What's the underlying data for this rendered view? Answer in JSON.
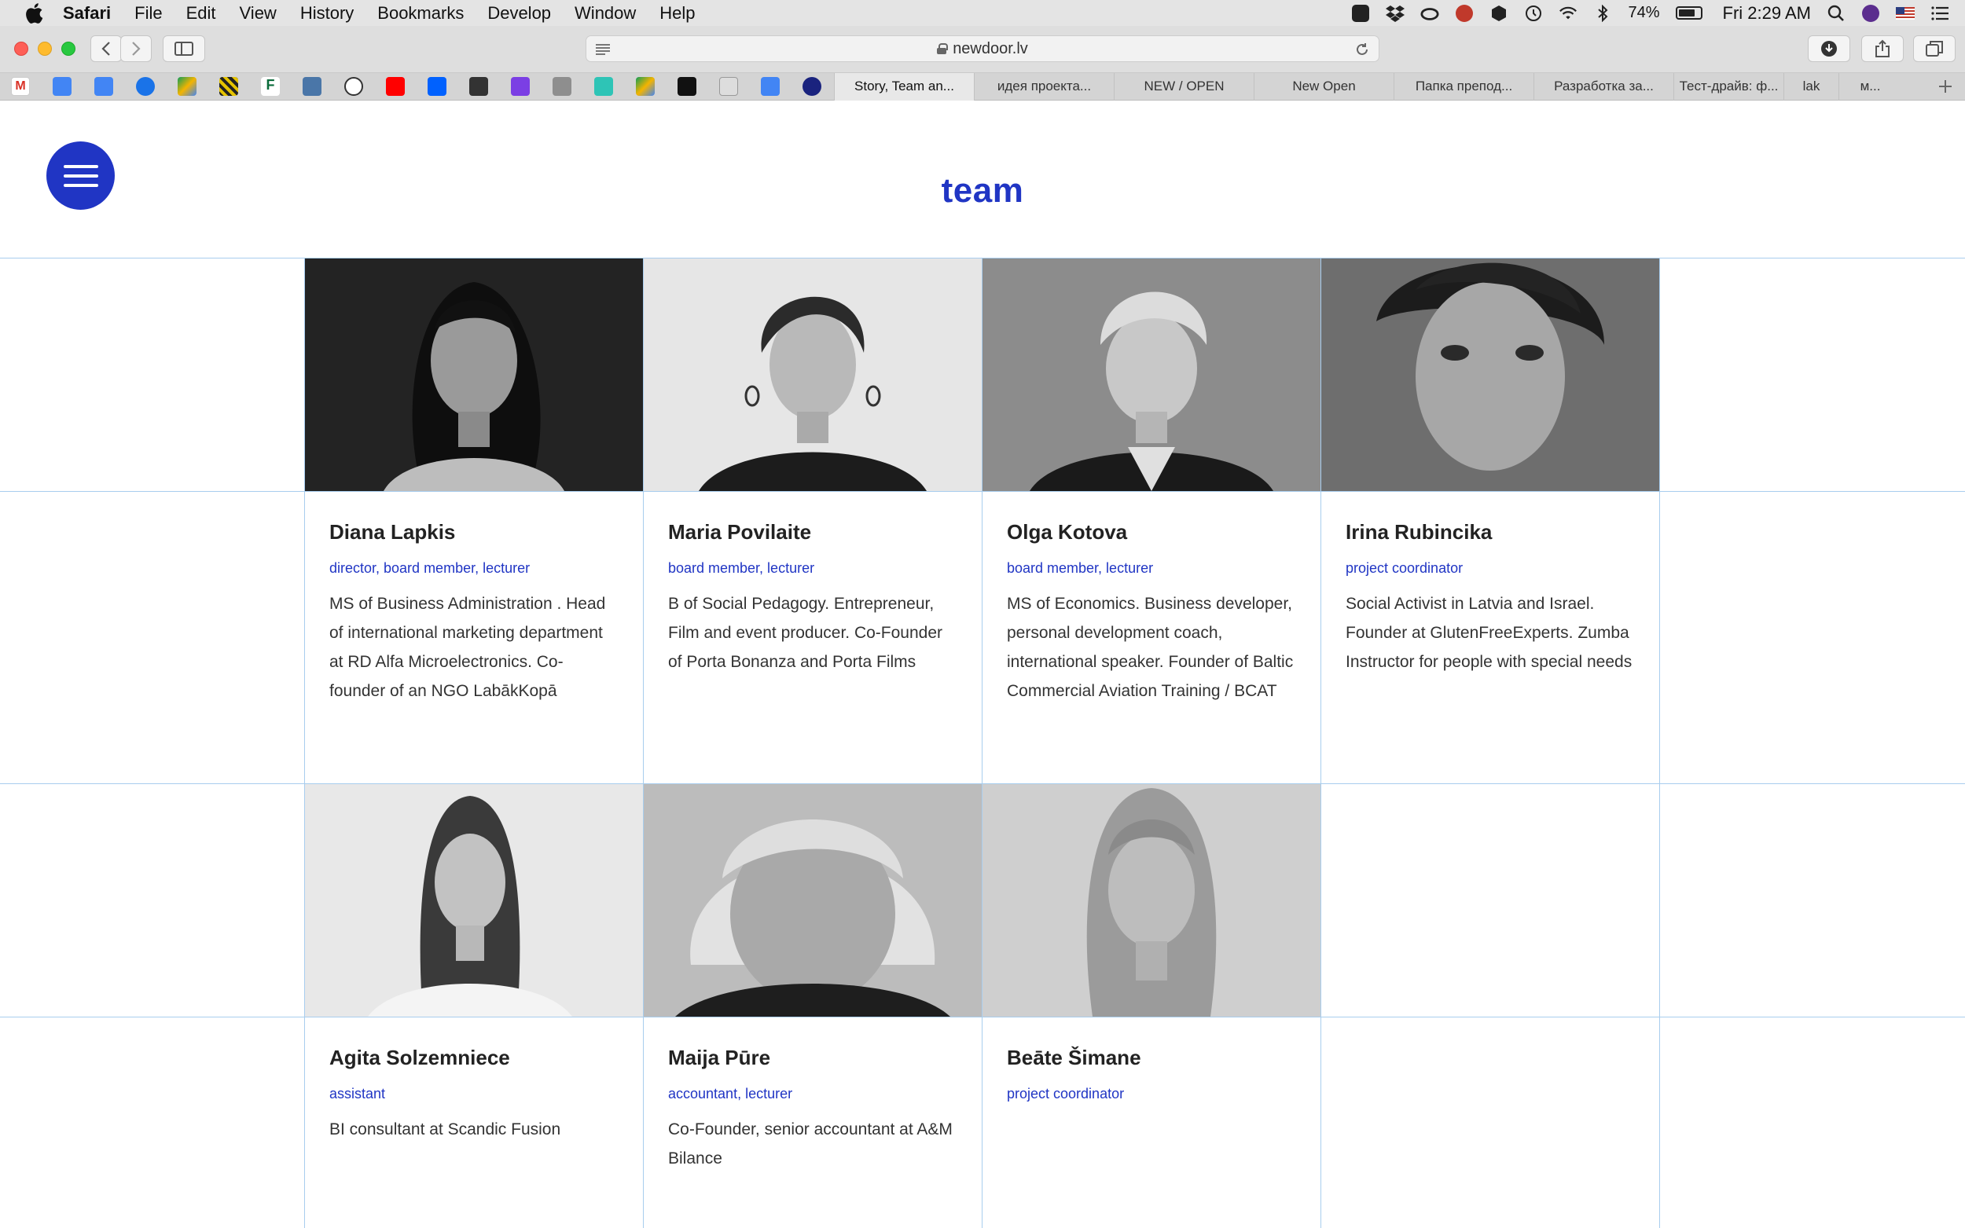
{
  "menubar": {
    "app": "Safari",
    "items": [
      "File",
      "Edit",
      "View",
      "History",
      "Bookmarks",
      "Develop",
      "Window",
      "Help"
    ],
    "battery": "74%",
    "clock": "Fri 2:29 AM"
  },
  "toolbar": {
    "url": "newdoor.lv"
  },
  "tabs": [
    "Story, Team an...",
    "идея проекта...",
    "NEW / OPEN",
    "New Open",
    "Папка препод...",
    "Разработка за...",
    "Тест-драйв: ф...",
    "lak",
    "м..."
  ],
  "page": {
    "title": "team"
  },
  "members": [
    {
      "name": "Diana Lapkis",
      "role": "director, board member, lecturer",
      "bio": "MS of Business Administration . Head of international marketing department at RD Alfa Microelectronics. Co-founder of an NGO LabākKopā"
    },
    {
      "name": "Maria Povilaite",
      "role": "board member, lecturer",
      "bio": "B of Social Pedagogy. Entrepreneur, Film and event producer. Co-Founder of Porta Bonanza and Porta Films"
    },
    {
      "name": "Olga Kotova",
      "role": "board member, lecturer",
      "bio": "MS of Economics. Business developer, personal development coach, international speaker. Founder of Baltic Commercial Aviation Training / BCAT"
    },
    {
      "name": "Irina Rubincika",
      "role": "project coordinator",
      "bio": "Social Activist in Latvia and Israel. Founder at GlutenFreeExperts. Zumba Instructor for people with special needs"
    },
    {
      "name": "Agita Solzemniece",
      "role": "assistant",
      "bio": "BI consultant at Scandic Fusion"
    },
    {
      "name": "Maija Pūre",
      "role": "accountant, lecturer",
      "bio": "Co-Founder, senior accountant at A&M Bilance"
    },
    {
      "name": "Beāte Šimane",
      "role": "project coordinator",
      "bio": ""
    }
  ]
}
